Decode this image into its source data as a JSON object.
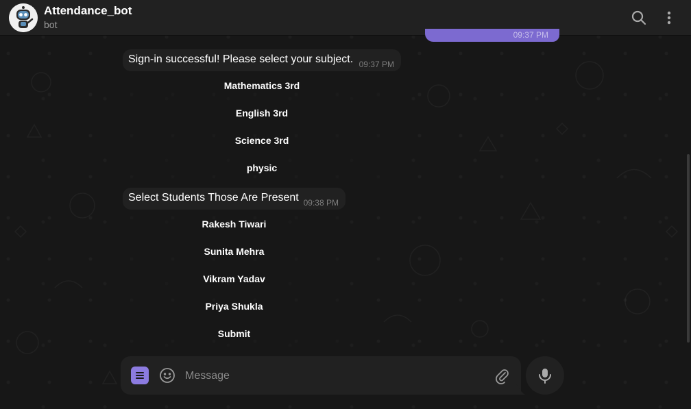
{
  "header": {
    "title": "Attendance_bot",
    "subtitle": "bot"
  },
  "outgoing_stub": {
    "time": "09:37 PM"
  },
  "messages": [
    {
      "text": "Sign-in successful! Please select your subject.",
      "time": "09:37 PM",
      "buttons": [
        "Mathematics 3rd",
        "English 3rd",
        "Science 3rd",
        "physic"
      ]
    },
    {
      "text": "Select Students Those Are Present",
      "time": "09:38 PM",
      "buttons": [
        "Rakesh Tiwari",
        "Sunita Mehra",
        "Vikram Yadav",
        "Priya Shukla",
        "Submit"
      ]
    }
  ],
  "composer": {
    "placeholder": "Message"
  },
  "icons": {
    "avatar": "robot-avatar-icon",
    "search": "search-icon",
    "menu": "more-vertical-icon",
    "bot_menu": "bot-menu-icon",
    "emoji": "emoji-icon",
    "attach": "paperclip-icon",
    "mic": "microphone-icon"
  },
  "colors": {
    "accent": "#8c7be0",
    "outgoing": "#7c6ad0",
    "bubble": "#212121",
    "header": "#212121",
    "background": "#171717"
  }
}
